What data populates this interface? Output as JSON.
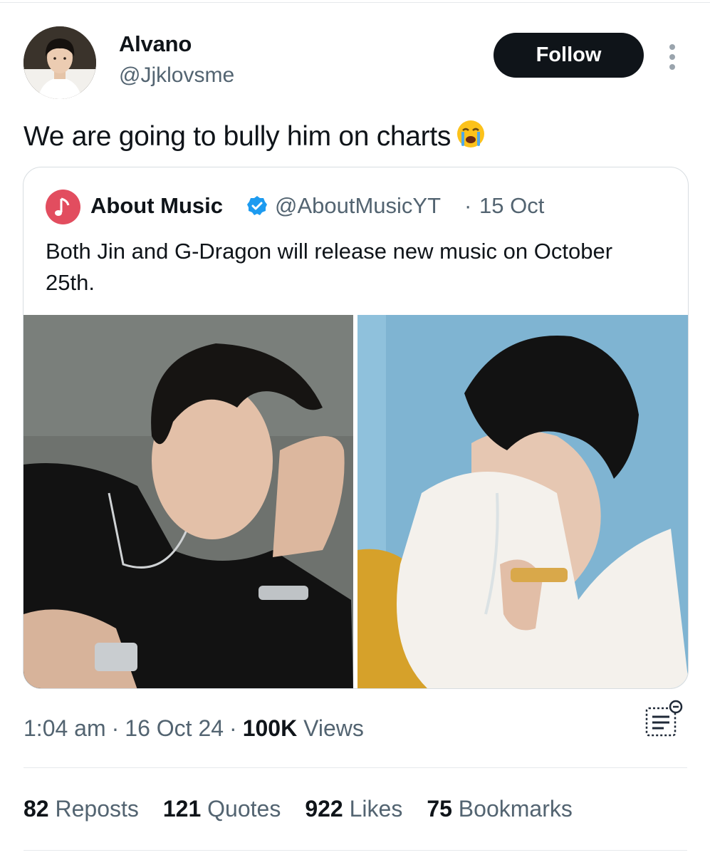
{
  "tweet": {
    "author": {
      "name": "Alvano",
      "handle": "@Jjklovsme"
    },
    "follow_label": "Follow",
    "text": "We are going to bully him on charts",
    "emoji": "loudly-crying-face-emoji",
    "quote": {
      "name": "About Music",
      "handle": "@AboutMusicYT",
      "separator": "·",
      "date": "15 Oct",
      "text": "Both Jin and G-Dragon will release new music on October 25th.",
      "avatar_icon": "music-note-icon",
      "avatar_color": "#e24d5f",
      "verified_color": "#1d9bf0"
    },
    "meta": {
      "time": "1:04 am",
      "date": "16 Oct 24",
      "views_count": "100K",
      "views_label": "Views",
      "separator": "·"
    },
    "stats": [
      {
        "count": "82",
        "label": "Reposts"
      },
      {
        "count": "121",
        "label": "Quotes"
      },
      {
        "count": "922",
        "label": "Likes"
      },
      {
        "count": "75",
        "label": "Bookmarks"
      }
    ]
  },
  "colors": {
    "text_primary": "#0f1419",
    "text_secondary": "#536471",
    "follow_bg": "#0f1419",
    "divider": "#e6e9ec"
  }
}
